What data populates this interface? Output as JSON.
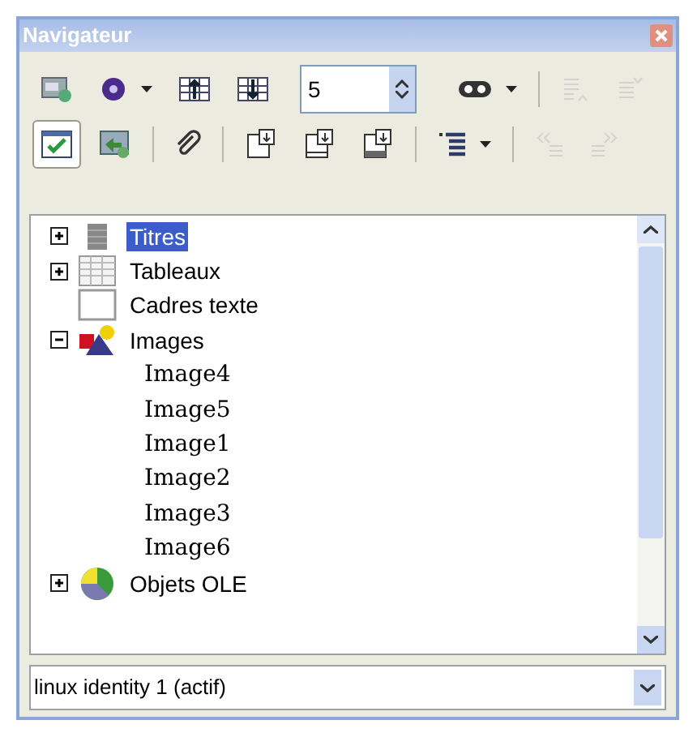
{
  "window": {
    "title": "Navigateur"
  },
  "toolbar_rows": [
    [
      {
        "kind": "button",
        "disabled": false
      },
      {
        "kind": "dropdown",
        "disabled": false
      },
      {
        "kind": "button",
        "disabled": false
      },
      {
        "kind": "button",
        "disabled": false
      },
      {
        "kind": "spinner",
        "value": "5"
      },
      {
        "kind": "dropdown",
        "disabled": false
      },
      {
        "kind": "separator"
      },
      {
        "kind": "button",
        "disabled": true
      },
      {
        "kind": "button",
        "disabled": true
      }
    ],
    [
      {
        "kind": "button",
        "disabled": false,
        "pressed": true
      },
      {
        "kind": "button",
        "disabled": false,
        "pressed": false
      },
      {
        "kind": "separator"
      },
      {
        "kind": "button",
        "disabled": false,
        "pressed": false
      },
      {
        "kind": "separator"
      },
      {
        "kind": "button",
        "disabled": false,
        "pressed": false
      },
      {
        "kind": "button",
        "disabled": false,
        "pressed": false
      },
      {
        "kind": "button",
        "disabled": false,
        "pressed": false
      },
      {
        "kind": "separator"
      },
      {
        "kind": "dropdown",
        "disabled": false
      },
      {
        "kind": "separator"
      },
      {
        "kind": "button",
        "disabled": true
      },
      {
        "kind": "button",
        "disabled": true
      }
    ]
  ],
  "tree": [
    {
      "label": "Titres",
      "kind": "node",
      "expanded": false,
      "selected": true
    },
    {
      "label": "Tableaux",
      "kind": "node",
      "expanded": false,
      "selected": false
    },
    {
      "label": "Cadres texte",
      "kind": "leaf",
      "selected": false
    },
    {
      "label": "Images",
      "kind": "node",
      "expanded": true,
      "selected": false,
      "children": [
        {
          "label": "Image4",
          "selected": false
        },
        {
          "label": "Image5",
          "selected": false
        },
        {
          "label": "Image1",
          "selected": false
        },
        {
          "label": "Image2",
          "selected": false
        },
        {
          "label": "Image3",
          "selected": false
        },
        {
          "label": "Image6",
          "selected": false
        }
      ]
    },
    {
      "label": "Objets OLE",
      "kind": "node",
      "expanded": false,
      "selected": false
    }
  ],
  "document_select": {
    "value": "linux identity 1 (actif)"
  }
}
